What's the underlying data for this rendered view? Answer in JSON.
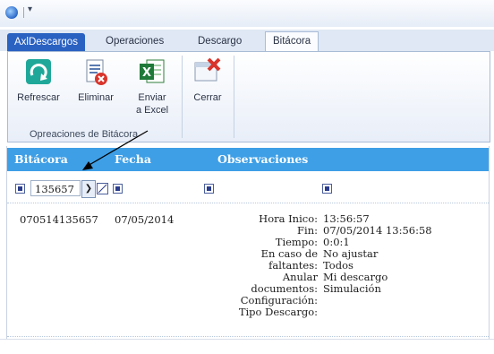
{
  "ribbon_tabs": [
    "AxlDescargos",
    "Operaciones",
    "Descargo",
    "Bitácora"
  ],
  "ribbon": {
    "refresh_label": "Refrescar",
    "delete_label": "Eliminar",
    "excel_label_line1": "Enviar",
    "excel_label_line2": "a Excel",
    "close_label": "Cerrar",
    "group_label": "Opreaciones de Bitácora"
  },
  "grid": {
    "columns": [
      "Bitácora",
      "Fecha",
      "Observaciones"
    ],
    "filter": {
      "value": "135657"
    },
    "row": {
      "bitacora": "070514135657",
      "fecha": "07/05/2014",
      "details": [
        {
          "label": "Hora Inico:",
          "value": "13:56:57"
        },
        {
          "label": "Fin:",
          "value": "07/05/2014 13:56:58"
        },
        {
          "label": "Tiempo:",
          "value": "0:0:1"
        },
        {
          "label": "En caso de",
          "value": "No ajustar"
        },
        {
          "label": "faltantes:",
          "value": "Todos"
        },
        {
          "label": "Anular",
          "value": "Mi descargo"
        },
        {
          "label": "documentos:",
          "value": "Simulación"
        },
        {
          "label": "Configuración:",
          "value": ""
        },
        {
          "label": "Tipo Descargo:",
          "value": ""
        }
      ]
    }
  },
  "colors": {
    "header": "#3e9fe6",
    "app_tab": "#2a62c2"
  }
}
